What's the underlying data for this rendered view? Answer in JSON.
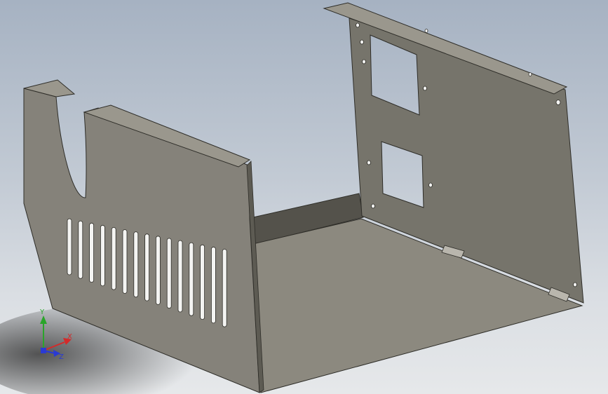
{
  "viewport": {
    "model": "sheet-metal-chassis",
    "colors": {
      "background_top": "#a6b2c2",
      "background_bottom": "#e6e8ea",
      "metal": "#807d73",
      "metal_dark": "#5a5850",
      "metal_light": "#8d8a80",
      "edge": "#2e2d28"
    }
  },
  "triad": {
    "x_label": "X",
    "y_label": "Y",
    "z_label": "Z",
    "colors": {
      "x": "#d42a2a",
      "y": "#2aa52a",
      "z": "#2a3ad4"
    }
  }
}
